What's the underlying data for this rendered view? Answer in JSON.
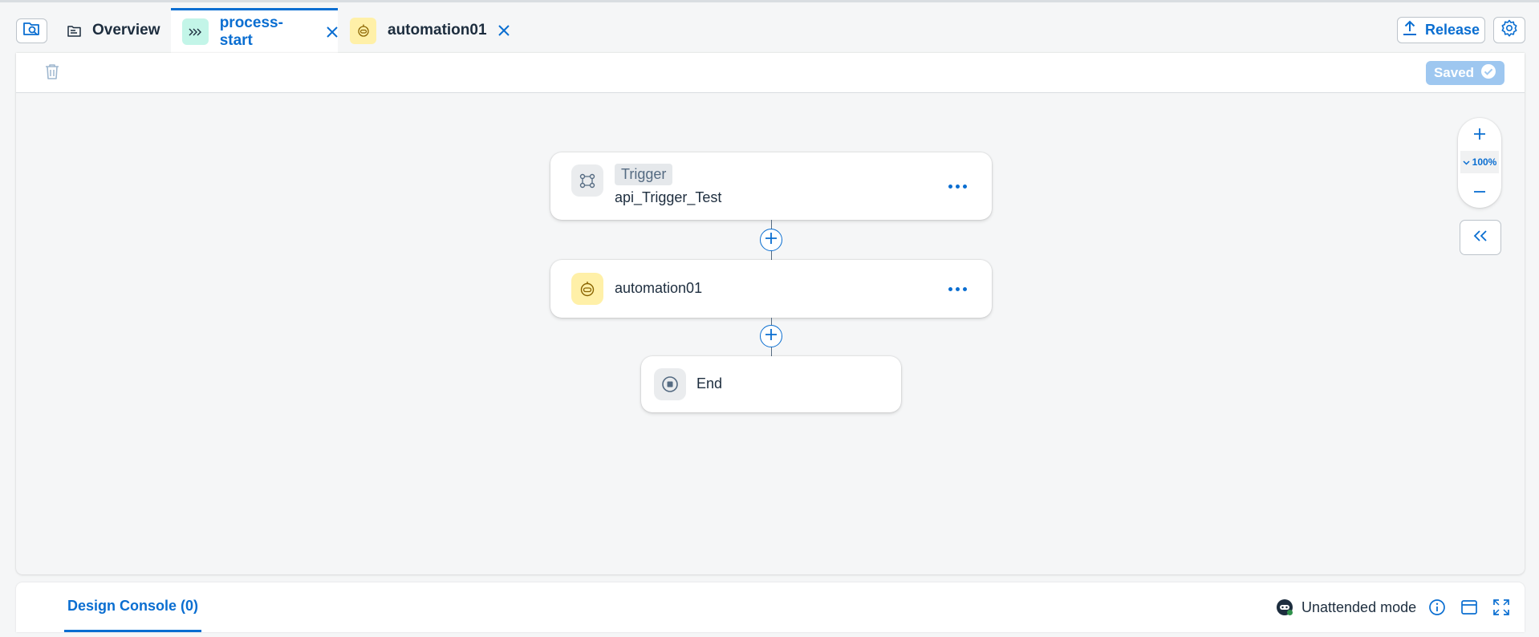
{
  "tabs": {
    "overview": "Overview",
    "process": "process-start",
    "automation": "automation01"
  },
  "header": {
    "release_label": "Release"
  },
  "toolbar": {
    "saved_label": "Saved"
  },
  "canvas": {
    "trigger_chip": "Trigger",
    "trigger_name": "api_Trigger_Test",
    "automation_name": "automation01",
    "end_label": "End",
    "zoom_level": "100%"
  },
  "console": {
    "tab_label": "Design Console (0)",
    "mode_label": "Unattended mode"
  },
  "colors": {
    "accent": "#0a6ed1",
    "text": "#1d2d3e",
    "background": "#f5f6f7",
    "saved_badge": "#9ec7f0",
    "process_badge": "#c3f5e8",
    "automation_badge": "#fff0a8"
  },
  "icons": {
    "search": "search-icon",
    "overview": "overview-icon",
    "process": "process-icon",
    "automation": "robot-icon",
    "close": "close-icon",
    "release": "upload-icon",
    "settings": "gear-icon",
    "delete": "trash-icon",
    "saved": "check-icon",
    "trigger": "api-icon",
    "end": "stop-icon",
    "more": "more-icon",
    "add": "add-icon",
    "zoom_in": "plus-icon",
    "zoom_out": "minus-icon",
    "zoom_menu": "chevron-down-icon",
    "collapse": "double-chevron-left-icon",
    "mode": "robot-icon",
    "info": "info-icon",
    "panel": "panel-icon",
    "expand": "fullscreen-icon"
  }
}
